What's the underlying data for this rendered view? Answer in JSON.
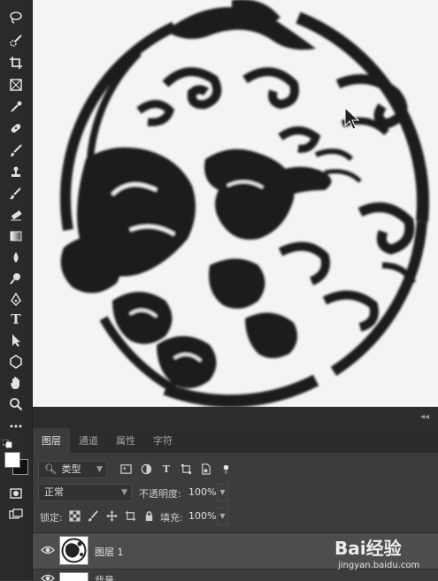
{
  "toolbar": {
    "tools": [
      "lasso-icon",
      "quick-selection-icon",
      "crop-icon",
      "frame-icon",
      "eyedropper-icon",
      "healing-brush-icon",
      "brush-icon",
      "clone-stamp-icon",
      "history-brush-icon",
      "eraser-icon",
      "gradient-icon",
      "blur-icon",
      "dodge-icon",
      "pen-icon",
      "type-icon",
      "path-selection-icon",
      "shape-icon",
      "hand-icon",
      "zoom-icon",
      "more-tools-icon"
    ],
    "type_tool_glyph": "T",
    "foreground_color": "#ffffff",
    "background_color": "#111111"
  },
  "canvas": {
    "background": "#f4f4f4",
    "ink": "#1c1c1c"
  },
  "panel": {
    "tabs": [
      "图层",
      "通道",
      "属性",
      "字符"
    ],
    "active_tab": "图层",
    "filter_kind": "类型",
    "blend_mode": "正常",
    "opacity_label": "不透明度:",
    "opacity_value": "100%",
    "lock_label": "锁定:",
    "fill_label": "填充:",
    "fill_value": "100%",
    "layers": [
      {
        "name": "图层 1",
        "visible": true,
        "selected": true
      },
      {
        "name": "背景",
        "visible": true,
        "selected": false
      }
    ]
  },
  "watermark": {
    "brand": "Bai经验",
    "url": "jingyan.baidu.com"
  }
}
